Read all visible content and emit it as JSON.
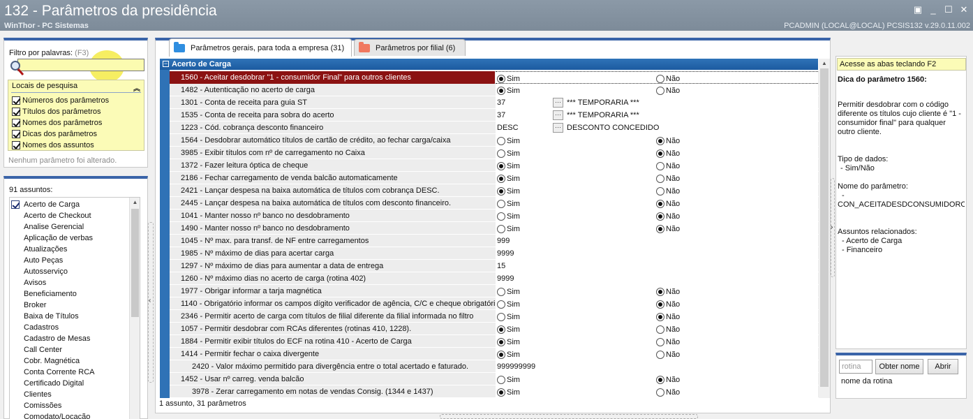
{
  "window": {
    "title": "132 - Parâmetros da presidência",
    "subtitle": "WinThor - PC Sistemas",
    "status": "PCADMIN (LOCAL@LOCAL)    PCSIS132  v.29.0.11.002",
    "buttons": [
      "minimize-icon",
      "restore-icon",
      "maximize-icon",
      "close-icon"
    ]
  },
  "filter": {
    "label": "Filtro por palavras:",
    "shortcut": "(F3)",
    "value": "",
    "search_locations_title": "Locais de pesquisa",
    "options": [
      {
        "label": "Números dos parâmetros",
        "checked": true
      },
      {
        "label": "Títulos dos parâmetros",
        "checked": true
      },
      {
        "label": "Nomes dos parâmetros",
        "checked": true
      },
      {
        "label": "Dicas dos parâmetros",
        "checked": true
      },
      {
        "label": "Nomes dos assuntos",
        "checked": true
      }
    ],
    "no_change_text": "Nenhum parâmetro foi alterado."
  },
  "subjects": {
    "count_label": "91 assuntos:",
    "items": [
      {
        "label": "Acerto de Carga",
        "checked": true
      },
      {
        "label": "Acerto de Checkout"
      },
      {
        "label": "Analise Gerencial"
      },
      {
        "label": "Aplicação de verbas"
      },
      {
        "label": "Atualizações"
      },
      {
        "label": "Auto Peças"
      },
      {
        "label": "Autosserviço"
      },
      {
        "label": "Avisos"
      },
      {
        "label": "Beneficiamento"
      },
      {
        "label": "Broker"
      },
      {
        "label": "Baixa de Títulos"
      },
      {
        "label": "Cadastros"
      },
      {
        "label": "Cadastro de Mesas"
      },
      {
        "label": "Call Center"
      },
      {
        "label": "Cobr. Magnética"
      },
      {
        "label": "Conta Corrente RCA"
      },
      {
        "label": "Certificado Digital"
      },
      {
        "label": "Clientes"
      },
      {
        "label": "Comissões"
      },
      {
        "label": "Comodato/Locação"
      }
    ]
  },
  "tabs": [
    {
      "label": "Parâmetros gerais, para toda a empresa",
      "count": "(31)",
      "color": "#2f8ee0",
      "active": true
    },
    {
      "label": "Parâmetros por filial",
      "count": "(6)",
      "color": "#f07860",
      "active": false
    }
  ],
  "grid": {
    "group": "Acerto de Carga",
    "yes": "Sim",
    "no": "Não",
    "rows": [
      {
        "desc": "1560 - Aceitar desdobrar \"1 - consumidor Final\" para outros clientes",
        "type": "bool",
        "value": "sim",
        "selected": true
      },
      {
        "desc": "1482 - Autenticação no acerto de carga",
        "type": "bool",
        "value": "sim"
      },
      {
        "desc": "1301 - Conta de receita para guia ST",
        "type": "lookup",
        "value": "37",
        "lookup": "*** TEMPORARIA ***"
      },
      {
        "desc": "1535 - Conta de receita para sobra do acerto",
        "type": "lookup",
        "value": "37",
        "lookup": "*** TEMPORARIA ***"
      },
      {
        "desc": "1223 - Cód. cobrança desconto financeiro",
        "type": "lookup",
        "value": "DESC",
        "lookup": "DESCONTO CONCEDIDO"
      },
      {
        "desc": "1564 - Desdobrar automático títulos de cartão de crédito, ao fechar carga/caixa",
        "type": "bool",
        "value": "nao"
      },
      {
        "desc": "3985 - Exibir títulos com nº de carregamento no Caixa",
        "type": "bool",
        "value": "nao"
      },
      {
        "desc": "1372 - Fazer leitura óptica de cheque",
        "type": "bool",
        "value": "sim"
      },
      {
        "desc": "2186 - Fechar carregamento de venda balcão automaticamente",
        "type": "bool",
        "value": "sim"
      },
      {
        "desc": "2421 - Lançar despesa na baixa automática de títulos com cobrança DESC.",
        "type": "bool",
        "value": "sim"
      },
      {
        "desc": "2445 - Lançar despesa na baixa automática de títulos com desconto financeiro.",
        "type": "bool",
        "value": "nao"
      },
      {
        "desc": "1041 - Manter nosso nº banco no desdobramento",
        "type": "bool",
        "value": "nao"
      },
      {
        "desc": "1490 - Manter nosso nº banco no desdobramento",
        "type": "bool",
        "value": "nao"
      },
      {
        "desc": "1045 - Nº max. para transf. de NF entre carregamentos",
        "type": "text",
        "value": "999"
      },
      {
        "desc": "1985 - Nº máximo de dias para acertar carga",
        "type": "text",
        "value": "9999"
      },
      {
        "desc": "1297 - Nº máximo de dias para aumentar a data de entrega",
        "type": "text",
        "value": "15"
      },
      {
        "desc": "1260 - Nº máximo dias no acerto de carga (rotina 402)",
        "type": "text",
        "value": "9999"
      },
      {
        "desc": "1977 - Obrigar informar a tarja magnética",
        "type": "bool",
        "value": "nao"
      },
      {
        "desc": "1140 - Obrigatório informar os campos dígito verificador de agência, C/C e cheque obrigatório",
        "type": "bool",
        "value": "nao"
      },
      {
        "desc": "2346 - Permitir acerto de carga com títulos de filial diferente da filial informada no filtro",
        "type": "bool",
        "value": "nao"
      },
      {
        "desc": "1057 - Permitir desdobrar com RCAs diferentes (rotinas 410, 1228).",
        "type": "bool",
        "value": "sim"
      },
      {
        "desc": "1884 - Permitir exibir títulos do ECF na rotina 410 - Acerto de Carga",
        "type": "bool",
        "value": "sim"
      },
      {
        "desc": "1414 - Permitir fechar o caixa divergente",
        "type": "bool",
        "value": "sim"
      },
      {
        "desc": "2420 - Valor máximo permitido para divergência entre o total acertado e faturado.",
        "type": "text",
        "value": "999999999",
        "indent": true
      },
      {
        "desc": "1452 - Usar nº carreg. venda balcão",
        "type": "bool",
        "value": "nao"
      },
      {
        "desc": "3978 - Zerar carregamento em notas de vendas Consig. (1344 e 1437)",
        "type": "bool",
        "value": "sim",
        "indent": true
      }
    ],
    "footer": "1 assunto, 31 parâmetros"
  },
  "tips": {
    "hint": "Acesse as abas teclando F2",
    "title": "Dica do parâmetro 1560:",
    "text": "Permitir desdobrar com o código diferente os títulos cujo cliente é \"1 - consumidor final\" para qualquer outro cliente.",
    "type_label": "Tipo de dados:",
    "type_value": "- Sim/Não",
    "name_label": "Nome do parâmetro:",
    "name_value": "-",
    "name_code": "CON_ACEITADESDCONSUMIDOROUT",
    "subjects_label": "Assuntos relacionados:",
    "subjects": [
      "- Acerto de Carga",
      "- Financeiro"
    ]
  },
  "routine": {
    "placeholder": "rotina",
    "get_name_button": "Obter nome",
    "open_button": "Abrir",
    "name_label": "nome da rotina"
  }
}
